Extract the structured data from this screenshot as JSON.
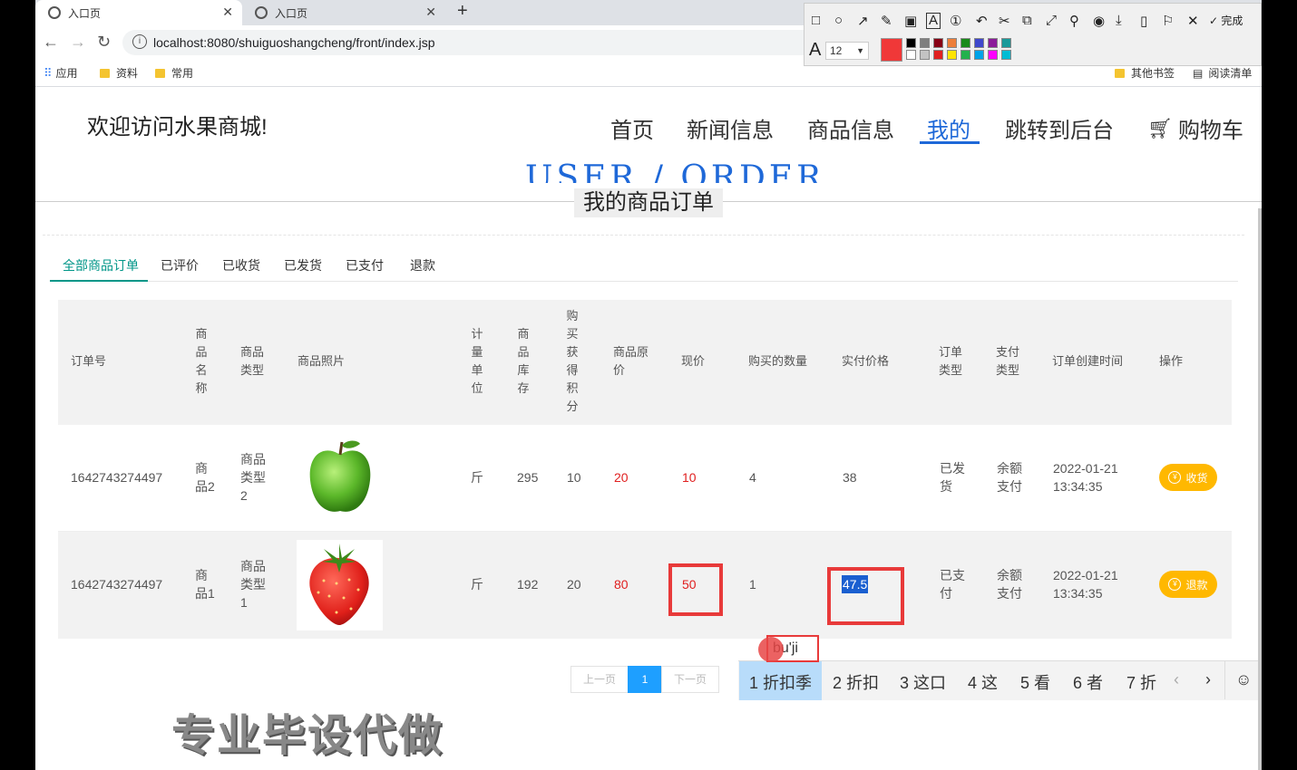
{
  "browser": {
    "tabs": [
      {
        "label": "入口页"
      },
      {
        "label": "入口页"
      }
    ],
    "new_tab": "+",
    "url": "localhost:8080/shuiguoshangcheng/front/index.jsp",
    "bookmarks": [
      "应用",
      "资料",
      "常用"
    ],
    "bookmarks_right": [
      "其他书签",
      "阅读清单"
    ]
  },
  "annotation_toolbar": {
    "font_size": "12",
    "done_label": "完成",
    "current_color": "#f03838",
    "swatches": [
      "#000000",
      "#7f7f7f",
      "#880015",
      "#ed7f3a",
      "#1a8a1a",
      "#3f48cc",
      "#8b1c99",
      "#1a9a9a",
      "#ffffff",
      "#c3c3c3",
      "#e02020",
      "#ffe400",
      "#22b14c",
      "#00a2e8",
      "#ff00ff",
      "#00bcd4"
    ]
  },
  "site": {
    "welcome": "欢迎访问水果商城!",
    "nav": [
      "首页",
      "新闻信息",
      "商品信息",
      "我的",
      "跳转到后台",
      "购物车"
    ],
    "section_big": "USER / ORDER",
    "section_title": "我的商品订单"
  },
  "order_tabs": [
    "全部商品订单",
    "已评价",
    "已收货",
    "已发货",
    "已支付",
    "退款"
  ],
  "table": {
    "headers": [
      "订单号",
      "商品名称",
      "商品类型",
      "商品照片",
      "计量单位",
      "商品库存",
      "购买获得积分",
      "商品原价",
      "现价",
      "购买的数量",
      "实付价格",
      "订单类型",
      "支付类型",
      "订单创建时间",
      "操作"
    ],
    "rows": [
      {
        "order_no": "1642743274497",
        "name": "商品2",
        "type": "商品类型2",
        "photo": "green-apple",
        "unit": "斤",
        "stock": "295",
        "points": "10",
        "original_price": "20",
        "price": "10",
        "qty": "4",
        "paid": "38",
        "order_type": "已发货",
        "pay_type": "余额支付",
        "created_date": "2022-01-21",
        "created_time": "13:34:35",
        "action": "收货"
      },
      {
        "order_no": "1642743274497",
        "name": "商品1",
        "type": "商品类型1",
        "photo": "strawberry",
        "unit": "斤",
        "stock": "192",
        "points": "20",
        "original_price": "80",
        "price": "50",
        "qty": "1",
        "paid": "47.5",
        "order_type": "已支付",
        "pay_type": "余额支付",
        "created_date": "2022-01-21",
        "created_time": "13:34:35",
        "action": "退款"
      }
    ]
  },
  "pager": {
    "prev": "上一页",
    "current": "1",
    "next": "下一页"
  },
  "ime": {
    "input": "bu'ji",
    "candidates": [
      "1 折扣季",
      "2 折扣",
      "3 这口",
      "4 这",
      "5 看",
      "6 者",
      "7 折"
    ]
  },
  "watermark": "专业毕设代做"
}
